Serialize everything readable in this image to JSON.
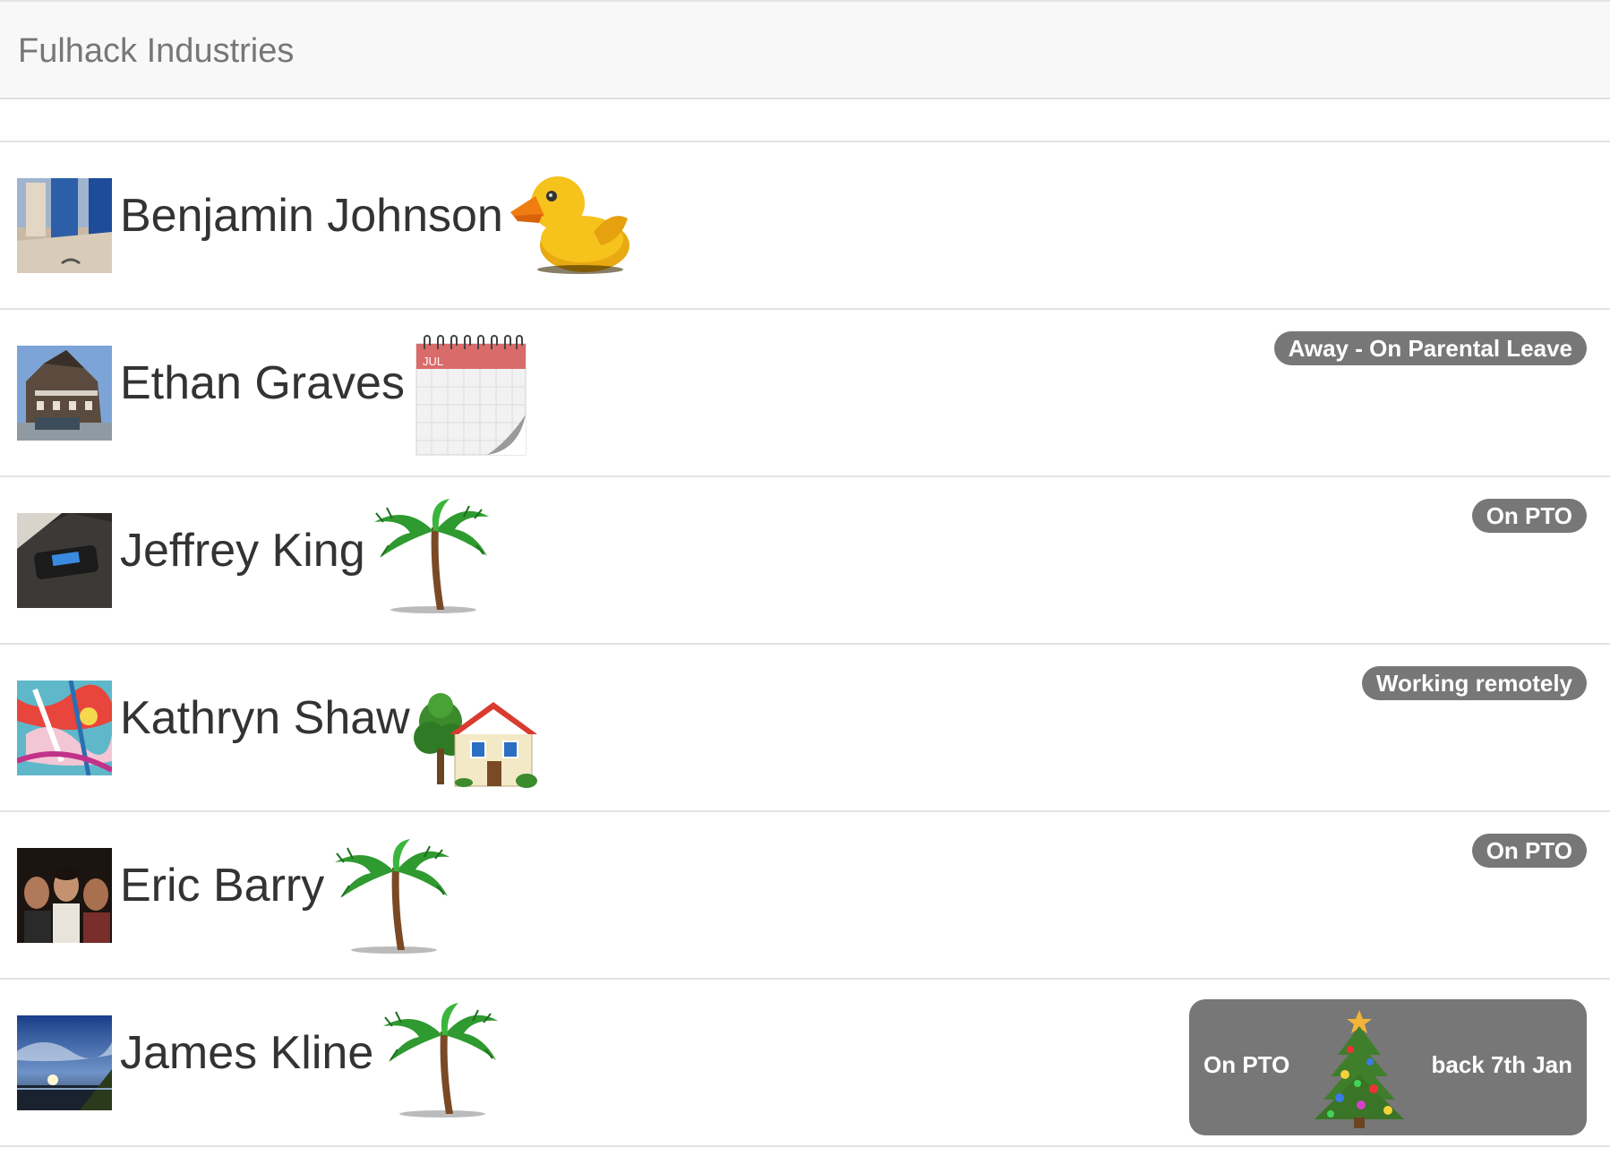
{
  "navbar": {
    "brand": "Fulhack Industries"
  },
  "people": [
    {
      "name": "Benjamin Johnson",
      "emoji": "rubber-duck-icon",
      "status": ""
    },
    {
      "name": "Ethan Graves",
      "emoji": "calendar-icon",
      "calendar_month": "JUL",
      "status": "Away - On Parental Leave"
    },
    {
      "name": "Jeffrey King",
      "emoji": "palm-tree-icon",
      "status": "On PTO"
    },
    {
      "name": "Kathryn Shaw",
      "emoji": "house-with-garden-icon",
      "status": "Working remotely"
    },
    {
      "name": "Eric Barry",
      "emoji": "palm-tree-icon",
      "status": "On PTO"
    },
    {
      "name": "James Kline",
      "emoji": "palm-tree-icon",
      "status_left": "On PTO",
      "status_emoji": "christmas-tree-icon",
      "status_right": "back 7th Jan"
    }
  ],
  "colors": {
    "badge": "#777777",
    "navbar_bg": "#f8f8f8",
    "divider": "#e3e3e3",
    "text": "#333333",
    "brand_text": "#777777"
  }
}
